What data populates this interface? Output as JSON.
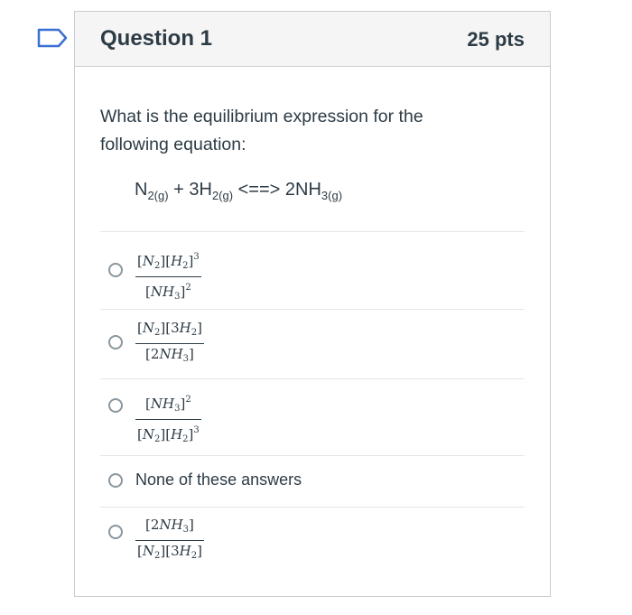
{
  "question": {
    "title": "Question 1",
    "points": "25 pts",
    "text": "What is the equilibrium expression for the following equation:",
    "equation": {
      "n": "N",
      "n_sub": "2(g)",
      "plus": " + 3H",
      "h_sub": "2(g)",
      "arrow": " <==> 2NH",
      "nh_sub": "3(g)"
    }
  },
  "answers": [
    {
      "type": "fraction",
      "numerator": "[N2][H2]^3",
      "denominator": "[NH3]^2"
    },
    {
      "type": "fraction",
      "numerator": "[N2][3H2]",
      "denominator": "[2NH3]"
    },
    {
      "type": "fraction",
      "numerator": "[NH3]^2",
      "denominator": "[N2][H2]^3"
    },
    {
      "type": "text",
      "label": "None of these answers"
    },
    {
      "type": "fraction",
      "numerator": "[2NH3]",
      "denominator": "[N2][3H2]"
    }
  ],
  "colors": {
    "text": "#2d3b45",
    "border": "#c7cdd1",
    "header_bg": "#f5f5f5",
    "flag": "#3b6fd4"
  },
  "icons": {
    "flag": "bookmark-flag-icon",
    "radio": "radio-button-icon"
  }
}
